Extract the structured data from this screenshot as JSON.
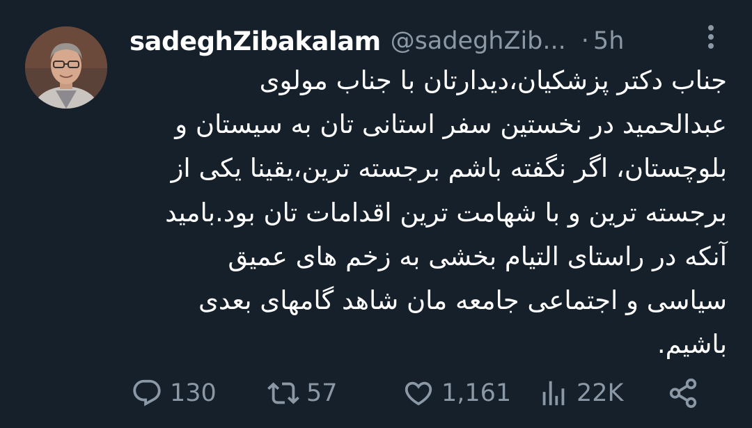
{
  "tweet": {
    "display_name": "sadeghZibakalam",
    "handle": "@sadeghZib...",
    "separator": "·",
    "time": "5h",
    "text": "جناب دکتر پزشکیان،دیدارتان با جناب مولوی\nعبدالحمید در نخستین سفر استانی تان به سیستان و\nبلوچستان، اگر نگفته باشم برجسته ترین،یقینا یکی از\nبرجسته ترین و با شهامت ترین اقدامات تان بود.بامید\nآنکه در راستای التیام بخشی به زخم های عمیق\nسیاسی و اجتماعی جامعه مان شاهد گامهای بعدی\nباشیم."
  },
  "actions": {
    "reply": {
      "icon": "reply-icon",
      "count": "130"
    },
    "retweet": {
      "icon": "retweet-icon",
      "count": "57"
    },
    "like": {
      "icon": "heart-icon",
      "count": "1,161"
    },
    "views": {
      "icon": "views-icon",
      "count": "22K"
    },
    "share": {
      "icon": "share-icon"
    }
  },
  "colors": {
    "background": "#15202b",
    "primary_text": "#ffffff",
    "secondary_text": "#8b98a5"
  }
}
